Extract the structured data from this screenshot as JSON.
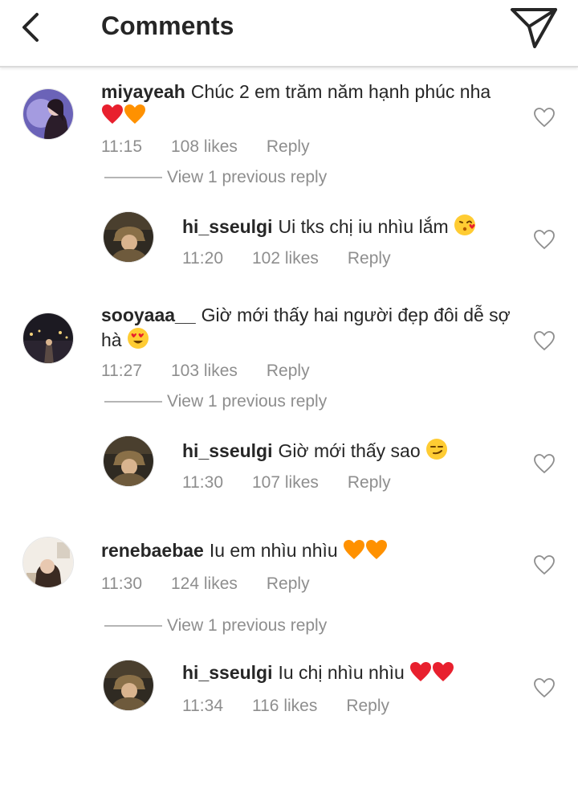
{
  "header": {
    "title": "Comments",
    "back_icon": "chevron-left-icon",
    "send_icon": "paper-plane-icon"
  },
  "view_replies_label": "View 1 previous reply",
  "comments": [
    {
      "username": "miyayeah",
      "text": "Chúc 2 em trăm năm hạnh phúc nha",
      "emojis": [
        "red-heart",
        "orange-heart"
      ],
      "time": "11:15",
      "likes": "108 likes",
      "reply": "Reply",
      "reply_item": {
        "username": "hi_sseulgi",
        "text": "Ui tks chị iu nhìu lắm",
        "emojis": [
          "kissing-face"
        ],
        "time": "11:20",
        "likes": "102 likes",
        "reply": "Reply"
      }
    },
    {
      "username": "sooyaaa__",
      "text": "Giờ mới thấy hai người đẹp đôi dễ sợ hà",
      "emojis": [
        "heart-eyes-face"
      ],
      "time": "11:27",
      "likes": "103 likes",
      "reply": "Reply",
      "reply_item": {
        "username": "hi_sseulgi",
        "text": "Giờ mới thấy sao",
        "emojis": [
          "smirk-face"
        ],
        "time": "11:30",
        "likes": "107 likes",
        "reply": "Reply"
      }
    },
    {
      "username": "renebaebae",
      "text": "Iu em nhìu nhìu",
      "emojis": [
        "orange-heart",
        "orange-heart"
      ],
      "time": "11:30",
      "likes": "124 likes",
      "reply": "Reply",
      "reply_item": {
        "username": "hi_sseulgi",
        "text": "Iu chị nhìu nhìu",
        "emojis": [
          "red-heart",
          "red-heart"
        ],
        "time": "11:34",
        "likes": "116 likes",
        "reply": "Reply"
      }
    }
  ],
  "colors": {
    "text": "#262626",
    "muted": "#8e8e8e",
    "heart_red": "#e8202e",
    "heart_orange": "#ff9100"
  }
}
